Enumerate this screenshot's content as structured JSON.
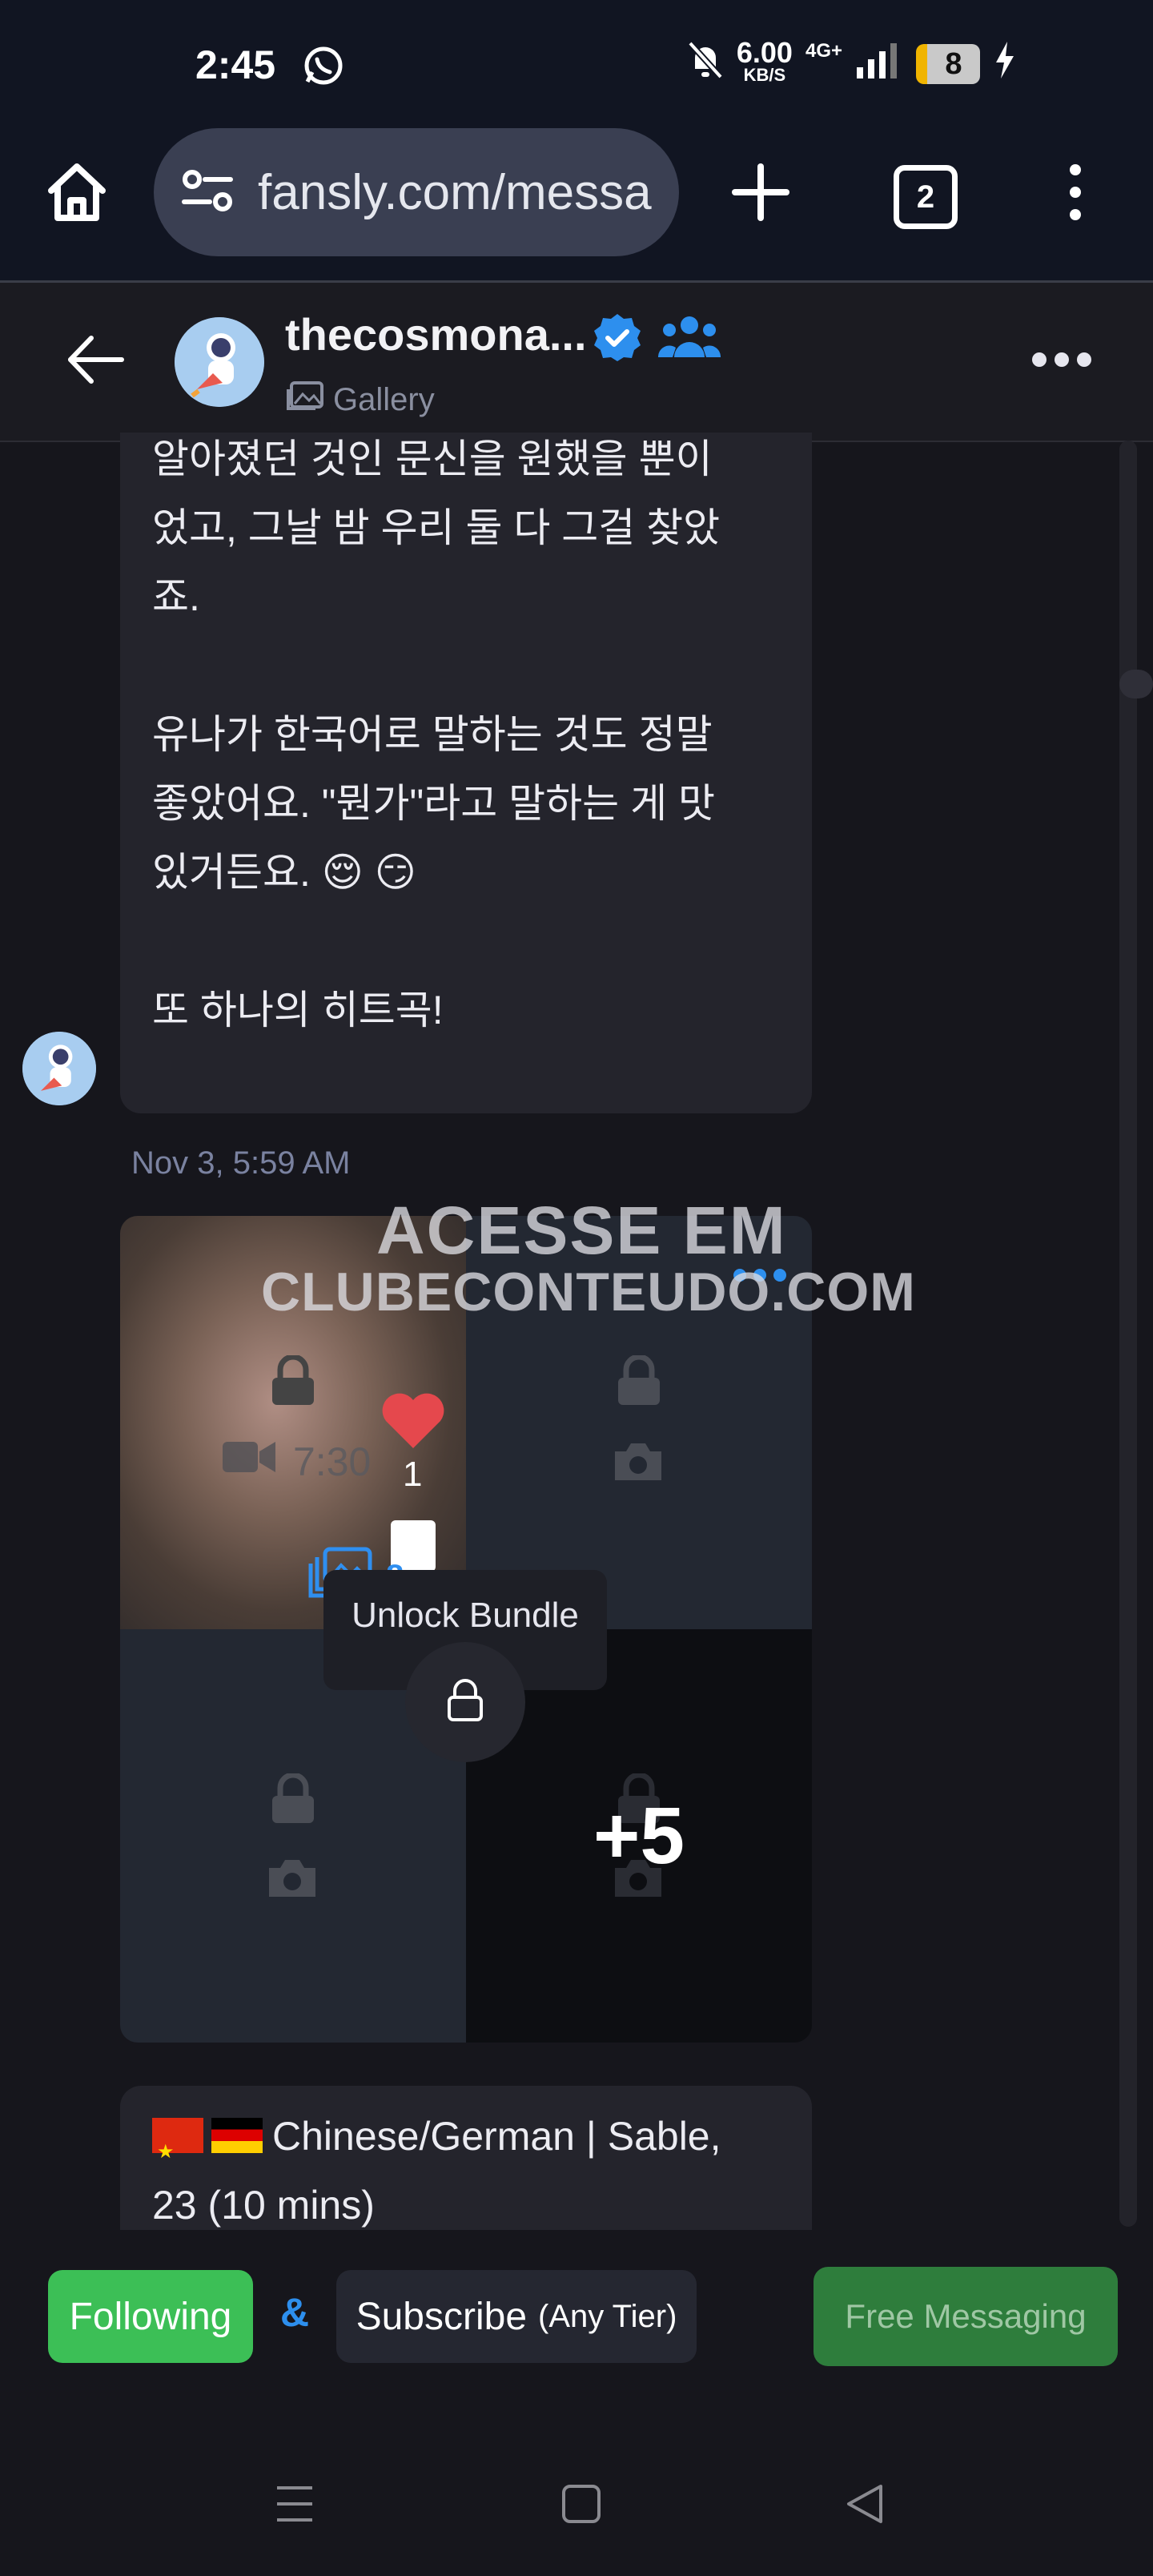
{
  "status_bar": {
    "time": "2:45",
    "net_speed_value": "6.00",
    "net_speed_unit": "KB/S",
    "network": "4G+",
    "battery": "8"
  },
  "browser": {
    "url": "fansly.com/messa",
    "tab_count": "2"
  },
  "chat_header": {
    "username": "thecosmona...",
    "subtitle": "Gallery"
  },
  "message1": {
    "lines": [
      "알아졌던 것인 문신을 원했을 뿐이",
      "었고, 그날 밤 우리 둘 다 그걸 찾았",
      "죠.",
      "",
      "유나가 한국어로 말하는 것도 정말",
      "좋았어요. \"뭔가\"라고 말하는 게 맛",
      "있거든요. 😌 😏",
      "",
      "또 하나의 히트곡!"
    ]
  },
  "timestamp": "Nov 3, 5:59 AM",
  "media": {
    "video_duration": "7:30",
    "likes": "1",
    "media_count": "8",
    "more_count": "+5",
    "unlock_label": "Unlock Bundle"
  },
  "watermark": {
    "line1": "ACESSE EM",
    "line2": "CLUBECONTEUDO.COM"
  },
  "message2": {
    "line1": "Chinese/German | Sable,",
    "line2": "23 (10 mins)"
  },
  "actions": {
    "following": "Following",
    "ampersand": "&",
    "subscribe": "Subscribe",
    "subscribe_tier": "(Any Tier)",
    "free_messaging": "Free Messaging"
  },
  "colors": {
    "accent_blue": "#2d8fee",
    "following_green": "#3cbf56",
    "free_messaging_green": "#2e7d3c",
    "background": "#16161c"
  }
}
